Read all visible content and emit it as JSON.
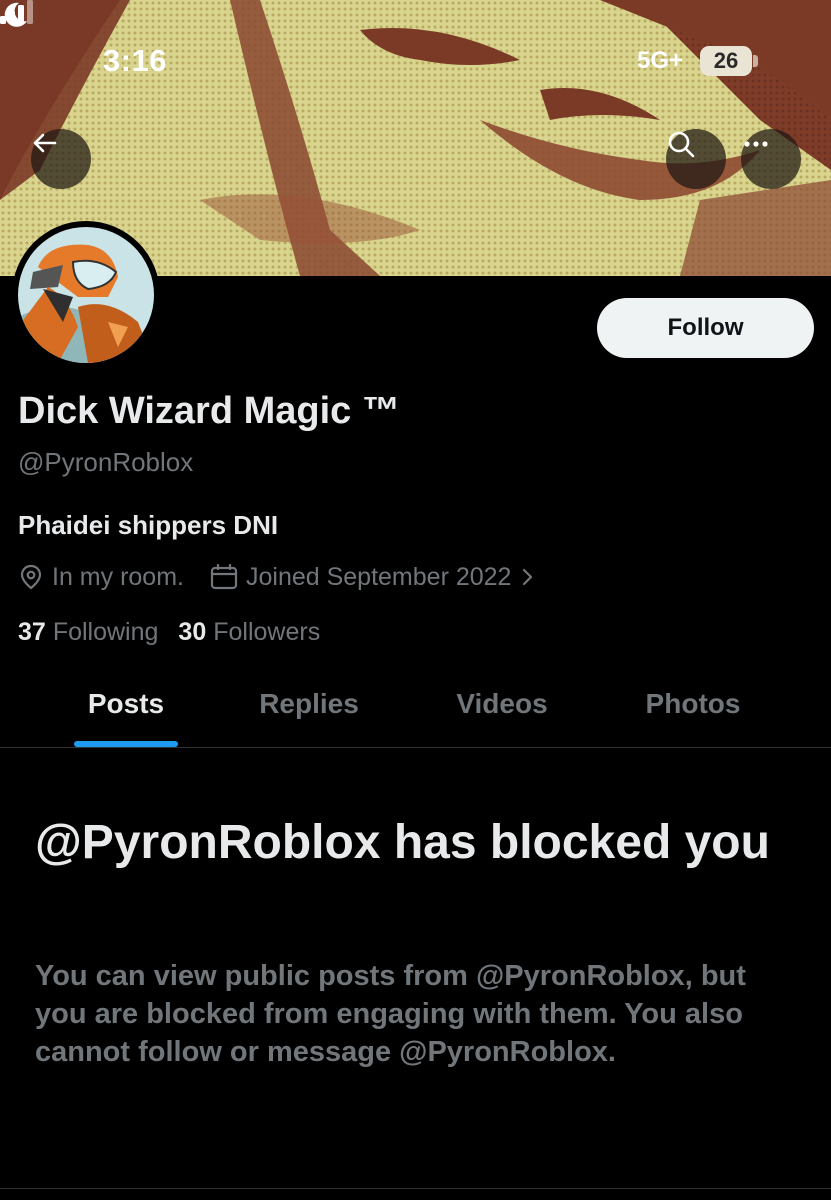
{
  "status_bar": {
    "time": "3:16",
    "network": "5G+",
    "battery": "26",
    "icons": [
      "moon-icon",
      "signal-icon"
    ]
  },
  "header": {
    "icons": [
      "back-arrow-icon",
      "search-icon",
      "more-icon"
    ]
  },
  "profile": {
    "follow_label": "Follow",
    "display_name": "Dick Wizard Magic ™",
    "handle": "@PyronRoblox",
    "bio": "Phaidei shippers DNI",
    "location": "In my room.",
    "joined": "Joined September 2022",
    "following_count": "37",
    "following_label": "Following",
    "followers_count": "30",
    "followers_label": "Followers"
  },
  "tabs": [
    {
      "label": "Posts",
      "active": true
    },
    {
      "label": "Replies",
      "active": false
    },
    {
      "label": "Videos",
      "active": false
    },
    {
      "label": "Photos",
      "active": false
    }
  ],
  "blocked": {
    "title": "@PyronRoblox has blocked you",
    "message": "You can view public posts from @PyronRoblox, but you are blocked from engaging with them. You also cannot follow or message @PyronRoblox."
  },
  "colors": {
    "background": "#000000",
    "accent": "#1d9bf0",
    "secondary_text": "#71767b",
    "primary_text": "#e7e9ea"
  }
}
